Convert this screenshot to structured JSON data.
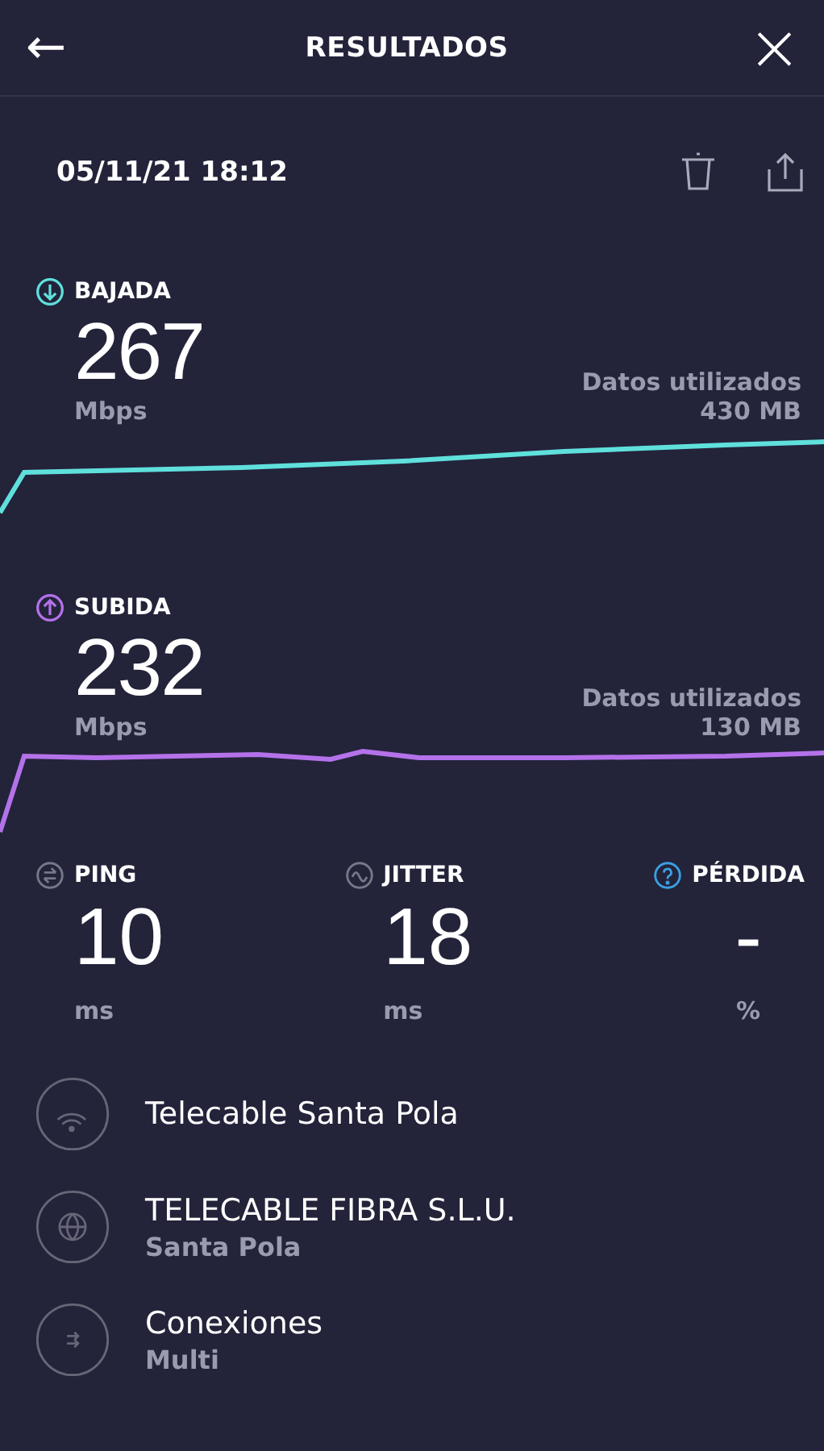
{
  "header": {
    "title": "RESULTADOS",
    "back": "←",
    "close": "×"
  },
  "result": {
    "timestamp": "05/11/21 18:12"
  },
  "speeds": [
    {
      "kind": "download",
      "label": "BAJADA",
      "value": "267",
      "unit": "Mbps",
      "data_label": "Datos utilizados",
      "data_amount": "430 MB",
      "color": "#5fe0dc"
    },
    {
      "kind": "upload",
      "label": "SUBIDA",
      "value": "232",
      "unit": "Mbps",
      "data_label": "Datos utilizados",
      "data_amount": "130 MB",
      "color": "#b472ea"
    }
  ],
  "metrics": [
    {
      "kind": "ping",
      "label": "PING",
      "value": "10",
      "unit": "ms"
    },
    {
      "kind": "jitter",
      "label": "JITTER",
      "value": "18",
      "unit": "ms"
    },
    {
      "kind": "loss",
      "label": "PÉRDIDA",
      "value": "-",
      "unit": "%"
    }
  ],
  "info": [
    {
      "kind": "wifi",
      "title": "Telecable Santa Pola"
    },
    {
      "kind": "globe",
      "title": "TELECABLE FIBRA S.L.U.",
      "subtitle": "Santa Pola"
    },
    {
      "kind": "connections",
      "title": "Conexiones",
      "subtitle": "Multi"
    }
  ]
}
